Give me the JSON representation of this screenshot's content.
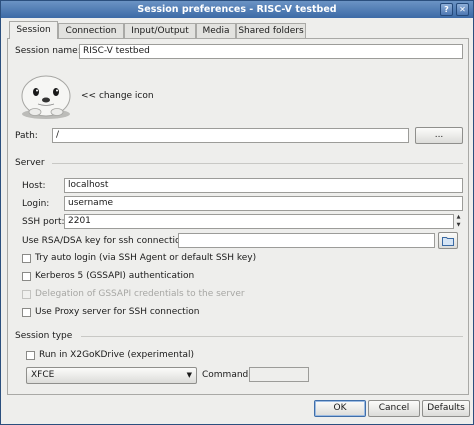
{
  "window": {
    "title": "Session preferences - RISC-V testbed",
    "help_button": "?",
    "close_button": "✕"
  },
  "tabs": [
    {
      "label": "Session",
      "active": true
    },
    {
      "label": "Connection"
    },
    {
      "label": "Input/Output"
    },
    {
      "label": "Media"
    },
    {
      "label": "Shared folders"
    }
  ],
  "session": {
    "name_label": "Session name:",
    "name_value": "RISC-V testbed",
    "icon_name": "seal-icon",
    "change_icon_label": "<< change icon",
    "path_label": "Path:",
    "path_value": "/",
    "browse_label": "..."
  },
  "server": {
    "section_label": "Server",
    "host_label": "Host:",
    "host_value": "localhost",
    "login_label": "Login:",
    "login_value": "username",
    "ssh_port_label": "SSH port:",
    "ssh_port_value": "2201",
    "key_label": "Use RSA/DSA key for ssh connection:",
    "key_value": "",
    "try_auto_login_label": "Try auto login (via SSH Agent or default SSH key)",
    "kerberos_label": "Kerberos 5 (GSSAPI) authentication",
    "delegation_label": "Delegation of GSSAPI credentials to the server",
    "proxy_label": "Use Proxy server for SSH connection"
  },
  "session_type": {
    "section_label": "Session type",
    "x2godrive_label": "Run in X2GoKDrive (experimental)",
    "type_value": "XFCE",
    "command_label": "Command:",
    "command_value": ""
  },
  "footer": {
    "ok_label": "OK",
    "cancel_label": "Cancel",
    "defaults_label": "Defaults"
  }
}
